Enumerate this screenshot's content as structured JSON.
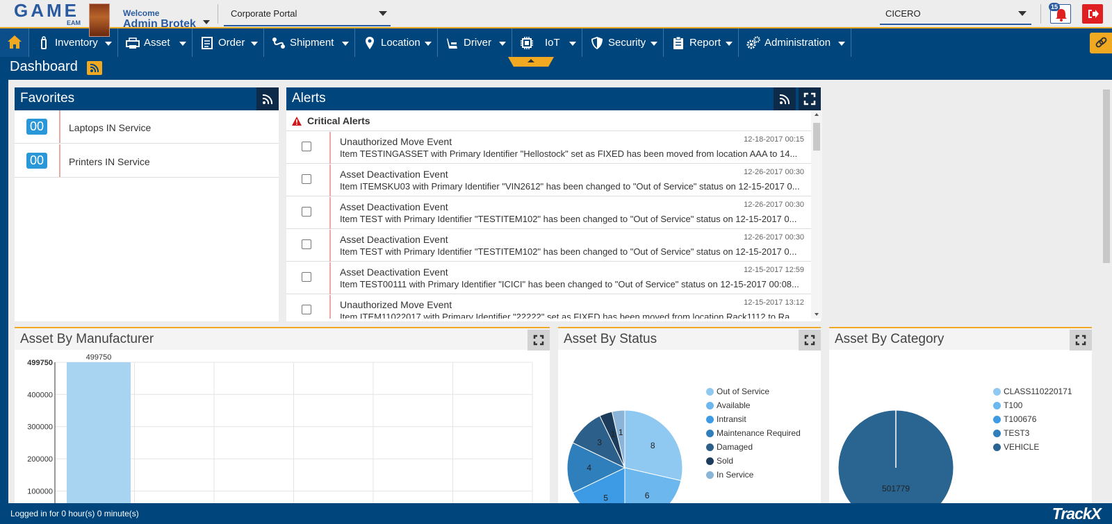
{
  "header": {
    "logo_text": "GAME",
    "logo_sub": "EAM",
    "welcome": "Welcome",
    "username": "Admin Brotek",
    "portal": "Corporate Portal",
    "site": "CICERO",
    "notification_count": "15"
  },
  "nav": {
    "items": [
      {
        "label": "Inventory",
        "icon": "tag-icon"
      },
      {
        "label": "Asset",
        "icon": "printer-icon"
      },
      {
        "label": "Order",
        "icon": "document-icon"
      },
      {
        "label": "Shipment",
        "icon": "route-icon"
      },
      {
        "label": "Location",
        "icon": "map-pin-icon"
      },
      {
        "label": "Driver",
        "icon": "seat-icon"
      },
      {
        "label": "IoT",
        "icon": "chip-icon"
      },
      {
        "label": "Security",
        "icon": "shield-icon"
      },
      {
        "label": "Report",
        "icon": "clipboard-icon"
      },
      {
        "label": "Administration",
        "icon": "gears-icon"
      }
    ]
  },
  "page": {
    "title": "Dashboard"
  },
  "favorites": {
    "title": "Favorites",
    "items": [
      {
        "count": "00",
        "label": "Laptops IN Service"
      },
      {
        "count": "00",
        "label": "Printers IN Service"
      }
    ]
  },
  "alerts": {
    "title": "Alerts",
    "section": "Critical Alerts",
    "items": [
      {
        "title": "Unauthorized Move Event",
        "time": "12-18-2017 00:15",
        "desc": "Item TESTINGASSET with Primary Identifier \"Hellostock\" set as FIXED has been moved from location AAA to 14..."
      },
      {
        "title": "Asset Deactivation Event",
        "time": "12-26-2017 00:30",
        "desc": "Item ITEMSKU03 with Primary Identifier \"VIN2612\" has been changed to \"Out of Service\" status on 12-15-2017 0..."
      },
      {
        "title": "Asset Deactivation Event",
        "time": "12-26-2017 00:30",
        "desc": "Item TEST with Primary Identifier \"TESTITEM102\" has been changed to \"Out of Service\" status on 12-15-2017 0..."
      },
      {
        "title": "Asset Deactivation Event",
        "time": "12-26-2017 00:30",
        "desc": "Item TEST with Primary Identifier \"TESTITEM102\" has been changed to \"Out of Service\" status on 12-15-2017 0..."
      },
      {
        "title": "Asset Deactivation Event",
        "time": "12-15-2017 12:59",
        "desc": "Item TEST00111 with Primary Identifier \"ICICI\" has been changed to \"Out of Service\" status on 12-15-2017 00:08..."
      },
      {
        "title": "Unauthorized Move Event",
        "time": "12-15-2017 13:12",
        "desc": "Item ITEM11022017 with Primary Identifier \"22222\" set as FIXED has been moved from location Rack1112 to Ra..."
      }
    ]
  },
  "panels": {
    "manufacturer_title": "Asset By Manufacturer",
    "status_title": "Asset By Status",
    "category_title": "Asset By Category"
  },
  "chart_data": [
    {
      "type": "bar",
      "title": "Asset By Manufacturer",
      "categories": [
        ""
      ],
      "values": [
        499750
      ],
      "y_ticks": [
        "100000",
        "200000",
        "300000",
        "400000",
        "499750"
      ],
      "data_labels": [
        "499750"
      ],
      "ylim": [
        0,
        499750
      ],
      "colors": [
        "#a8d4f2"
      ]
    },
    {
      "type": "pie",
      "title": "Asset By Status",
      "labels": [
        "Out of Service",
        "Available",
        "Intransit",
        "Maintenance Required",
        "Damaged",
        "Sold",
        "In Service"
      ],
      "values": [
        8,
        6,
        5,
        4,
        3,
        1,
        1
      ],
      "colors": [
        "#8fc8f0",
        "#6cb7ee",
        "#3c9be4",
        "#2f7fbd",
        "#2c5f8a",
        "#1d3c5c",
        "#8ab4d8"
      ]
    },
    {
      "type": "pie",
      "title": "Asset By Category",
      "labels": [
        "CLASS110220171",
        "T100",
        "T100676",
        "TEST3",
        "VEHICLE"
      ],
      "values": [
        0,
        0,
        0,
        0,
        501779
      ],
      "slice_labels": [
        "",
        "",
        "",
        "",
        "501779"
      ],
      "colors": [
        "#8fc8f0",
        "#6cb7ee",
        "#3c9be4",
        "#2f7fbd",
        "#2a6591"
      ]
    }
  ],
  "footer": {
    "login_text": "Logged in for 0 hour(s) 0 minute(s)",
    "brand": "TrackX"
  }
}
